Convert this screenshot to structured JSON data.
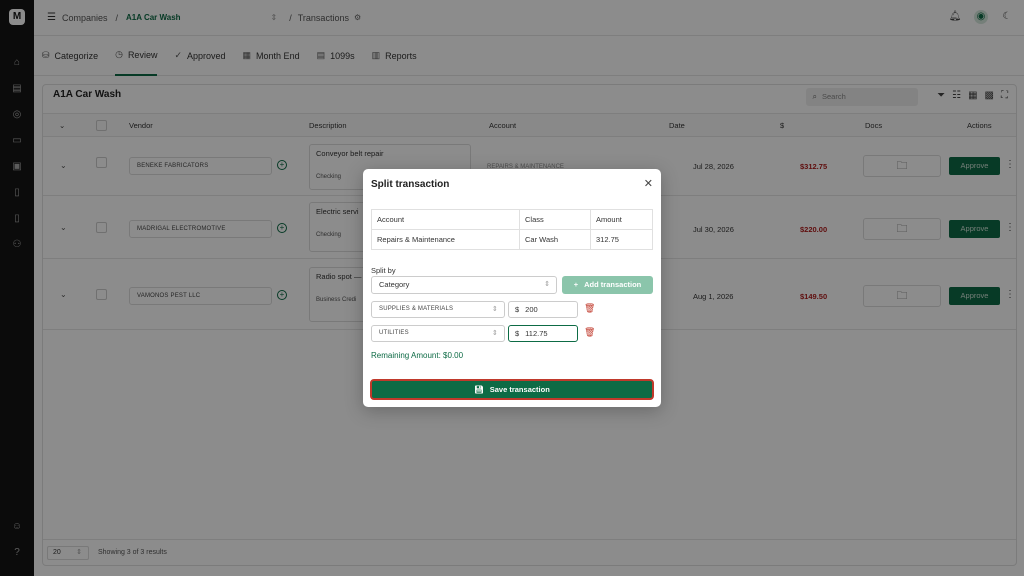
{
  "nav": {
    "menu_label": "Companies",
    "company": "A1A Car Wash",
    "page": "Transactions"
  },
  "tabs": [
    {
      "label": "Categorize"
    },
    {
      "label": "Review"
    },
    {
      "label": "Approved"
    },
    {
      "label": "Month End"
    },
    {
      "label": "1099s"
    },
    {
      "label": "Reports"
    }
  ],
  "card": {
    "title": "A1A Car Wash",
    "search_placeholder": "Search"
  },
  "table": {
    "headers": {
      "vendor": "Vendor",
      "description": "Description",
      "account": "Account",
      "date": "Date",
      "amount": "$",
      "docs": "Docs",
      "actions": "Actions"
    },
    "rows": [
      {
        "vendor": "BENEKE FABRICATORS",
        "description": "Conveyor belt repair",
        "source": "Checking",
        "account": "REPAIRS & MAINTENANCE",
        "date": "Jul 28, 2026",
        "amount": "$312.75",
        "action": "Approve"
      },
      {
        "vendor": "MADRIGAL ELECTROMOTIVE",
        "description": "Electric servi",
        "source": "Checking",
        "account": "",
        "date": "Jul 30, 2026",
        "amount": "$220.00",
        "action": "Approve"
      },
      {
        "vendor": "VAMONOS PEST LLC",
        "description": "Radio spot —",
        "source": "Business Credi",
        "account": "",
        "date": "Aug 1, 2026",
        "amount": "$149.50",
        "action": "Approve"
      }
    ],
    "page_size": "20",
    "results_text": "Showing 3 of 3 results"
  },
  "modal": {
    "title": "Split transaction",
    "table": {
      "headers": [
        "Account",
        "Class",
        "Amount"
      ],
      "row": [
        "Repairs & Maintenance",
        "Car Wash",
        "312.75"
      ]
    },
    "split_by_label": "Split by",
    "split_by_value": "Category",
    "add_button": "Add transaction",
    "splits": [
      {
        "category": "SUPPLIES & MATERIALS",
        "currency": "$",
        "amount": "200"
      },
      {
        "category": "UTILITIES",
        "currency": "$",
        "amount": "112.75"
      }
    ],
    "remaining": "Remaining Amount: $0.00",
    "save_button": "Save transaction"
  },
  "colors": {
    "accent": "#0d6b45",
    "negative": "#b01c1c",
    "highlight_border": "#c0392b"
  }
}
